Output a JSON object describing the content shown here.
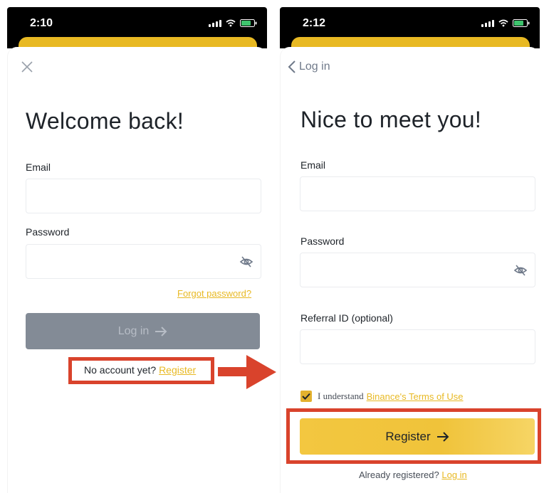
{
  "left": {
    "status_time": "2:10",
    "title": "Welcome back!",
    "email_label": "Email",
    "password_label": "Password",
    "forgot_password": "Forgot password?",
    "login_button": "Log in",
    "no_account_text": "No account yet?",
    "register_link": "Register"
  },
  "right": {
    "status_time": "2:12",
    "back_label": "Log in",
    "title": "Nice to meet you!",
    "email_label": "Email",
    "password_label": "Password",
    "referral_label": "Referral ID (optional)",
    "terms_prefix": "I understand",
    "terms_link": "Binance's Terms of Use",
    "terms_checked": true,
    "register_button": "Register",
    "already_registered": "Already registered?",
    "login_link": "Log in"
  },
  "colors": {
    "accent": "#e8b923",
    "highlight_box": "#d9432c",
    "disabled_button": "#838b96"
  },
  "icons": [
    "close-icon",
    "eye-off-icon",
    "arrow-right-icon",
    "chevron-left-icon",
    "checkmark-icon",
    "wifi-icon",
    "battery-icon",
    "signal-icon"
  ]
}
